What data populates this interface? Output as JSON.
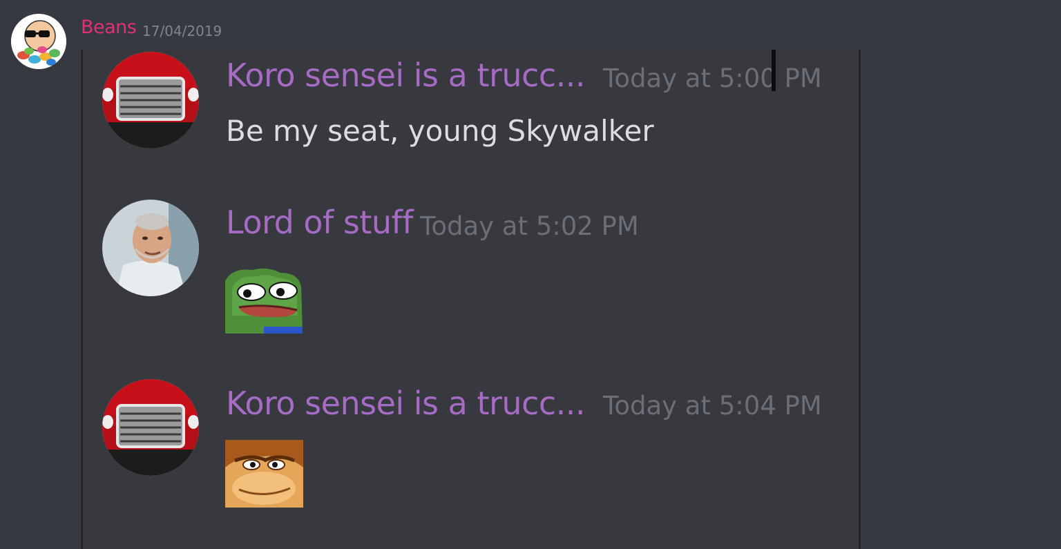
{
  "outer": {
    "author": "Beans",
    "date": "17/04/2019",
    "author_color": "#e0307a",
    "avatar_icon": "beans-sunglasses-avatar-icon"
  },
  "messages": [
    {
      "author": "Koro sensei is a trucc...",
      "time": "Today at 5:00 PM",
      "text": "Be my seat, young Skywalker",
      "avatar_icon": "red-truck-avatar-icon"
    },
    {
      "author": "Lord of stuff",
      "time": "Today at 5:02 PM",
      "emoji": "pepe-frog-emoji",
      "avatar_icon": "old-man-avatar-icon"
    },
    {
      "author": "Koro sensei is a trucc...",
      "time": "Today at 5:04 PM",
      "emoji": "donkey-kong-face-emoji",
      "avatar_icon": "red-truck-avatar-icon"
    }
  ],
  "colors": {
    "background": "#36393f",
    "username": "#a66bc5",
    "timestamp": "#6b6e75",
    "message_text": "#dcddde"
  }
}
